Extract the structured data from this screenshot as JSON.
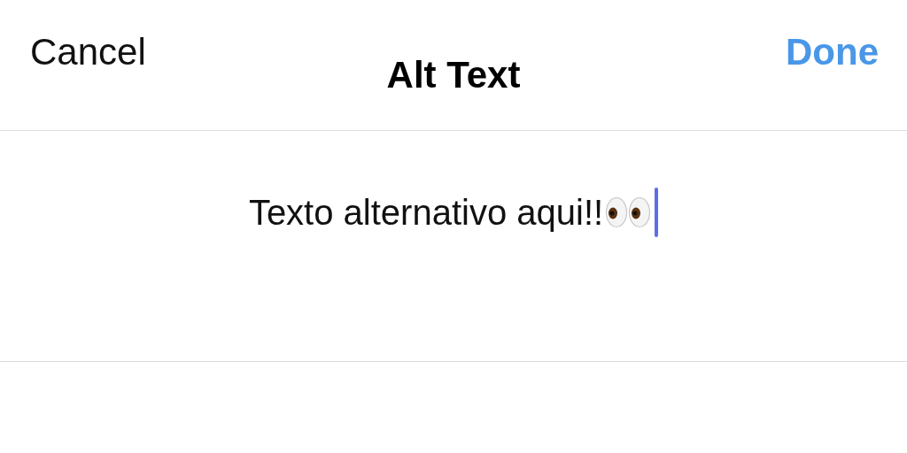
{
  "nav_bar": {
    "cancel": "Cancel",
    "title": "Alt Text",
    "done": "Done"
  },
  "alt_text_field": {
    "value": "Texto alternativo aqui!!",
    "focused": true
  }
}
